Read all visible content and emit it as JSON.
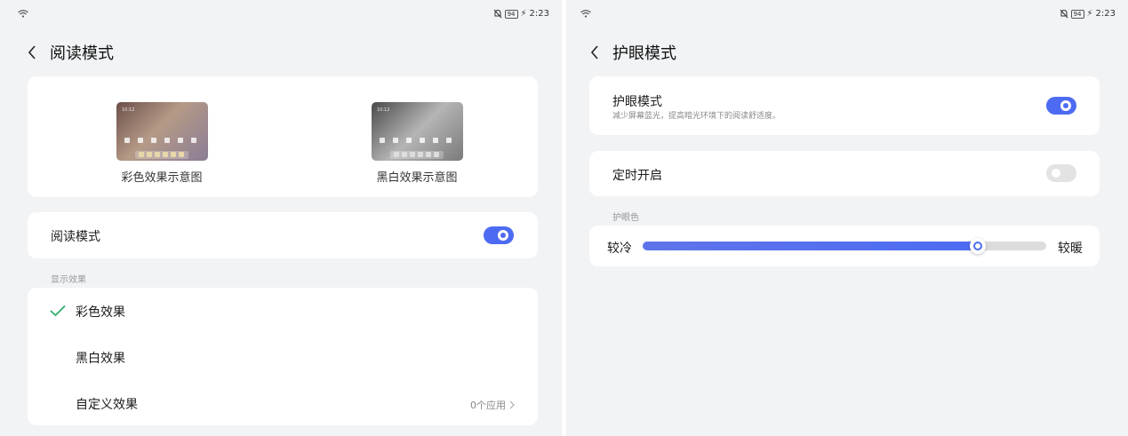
{
  "left": {
    "status": {
      "battery": "94",
      "time": "2:23"
    },
    "title": "阅读模式",
    "previews": {
      "color_caption": "彩色效果示意图",
      "bw_caption": "黑白效果示意图",
      "screen_time": "10:12"
    },
    "reading_mode": {
      "label": "阅读模式",
      "enabled": true
    },
    "section_label": "显示效果",
    "options": [
      {
        "label": "彩色效果",
        "selected": true
      },
      {
        "label": "黑白效果",
        "selected": false
      },
      {
        "label": "自定义效果",
        "selected": false,
        "trail": "0个应用"
      }
    ]
  },
  "right": {
    "status": {
      "battery": "94",
      "time": "2:23"
    },
    "title": "护眼模式",
    "eye_care": {
      "label": "护眼模式",
      "description": "减少屏幕蓝光，提高暗光环境下的阅读舒适度。",
      "enabled": true
    },
    "schedule": {
      "label": "定时开启",
      "enabled": false
    },
    "color_section_label": "护眼色",
    "color_slider": {
      "min_label": "较冷",
      "max_label": "较暖",
      "value_fraction": 0.83
    }
  },
  "colors": {
    "accent": "#4d6bf2",
    "check": "#2eae6d"
  },
  "icons": [
    "wifi-icon",
    "mute-icon",
    "battery-icon",
    "charging-icon",
    "back-icon",
    "checkmark-icon",
    "chevron-right-icon"
  ]
}
